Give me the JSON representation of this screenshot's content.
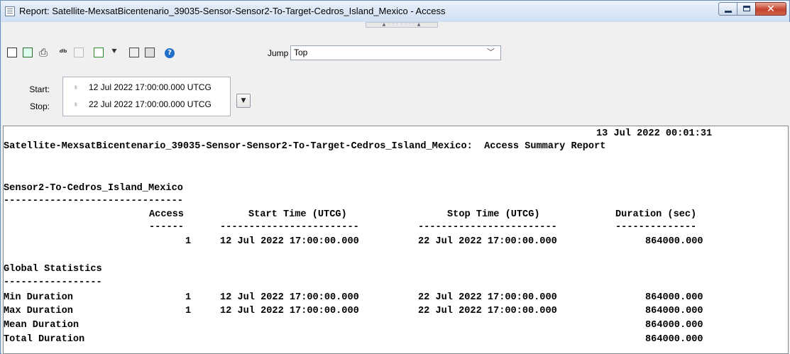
{
  "window": {
    "title": "Report:  Satellite-MexsatBicentenario_39035-Sensor-Sensor2-To-Target-Cedros_Island_Mexico - Access"
  },
  "toolbar": {
    "icons": [
      "save-icon",
      "export-excel-icon",
      "print-icon",
      "find-icon",
      "copy-icon",
      "refresh-icon",
      "filter-icon",
      "properties-icon",
      "options-icon",
      "help-icon"
    ],
    "jump_label": "Jump",
    "jump_value": "Top"
  },
  "time": {
    "start_label": "Start:",
    "stop_label": "Stop:",
    "start_value": "12 Jul 2022 17:00:00.000 UTCG",
    "stop_value": "22 Jul 2022 17:00:00.000 UTCG"
  },
  "report": {
    "timestamp": "13 Jul 2022 00:01:31",
    "header": "Satellite-MexsatBicentenario_39035-Sensor-Sensor2-To-Target-Cedros_Island_Mexico:  Access Summary Report",
    "section_title": "Sensor2-To-Cedros_Island_Mexico",
    "section_rule": "-------------------------------",
    "columns": [
      "Access",
      "Start Time (UTCG)",
      "Stop Time (UTCG)",
      "Duration (sec)"
    ],
    "column_rules": [
      "------",
      "------------------------",
      "------------------------",
      "--------------"
    ],
    "rows": [
      {
        "access": "1",
        "start": "12 Jul 2022 17:00:00.000",
        "stop": "22 Jul 2022 17:00:00.000",
        "duration": "864000.000"
      }
    ],
    "stats_title": "Global Statistics",
    "stats_rule": "-----------------",
    "stats": [
      {
        "label": "Min Duration",
        "access": "1",
        "start": "12 Jul 2022 17:00:00.000",
        "stop": "22 Jul 2022 17:00:00.000",
        "duration": "864000.000"
      },
      {
        "label": "Max Duration",
        "access": "1",
        "start": "12 Jul 2022 17:00:00.000",
        "stop": "22 Jul 2022 17:00:00.000",
        "duration": "864000.000"
      },
      {
        "label": "Mean Duration",
        "access": "",
        "start": "",
        "stop": "",
        "duration": "864000.000"
      },
      {
        "label": "Total Duration",
        "access": "",
        "start": "",
        "stop": "",
        "duration": "864000.000"
      }
    ]
  }
}
